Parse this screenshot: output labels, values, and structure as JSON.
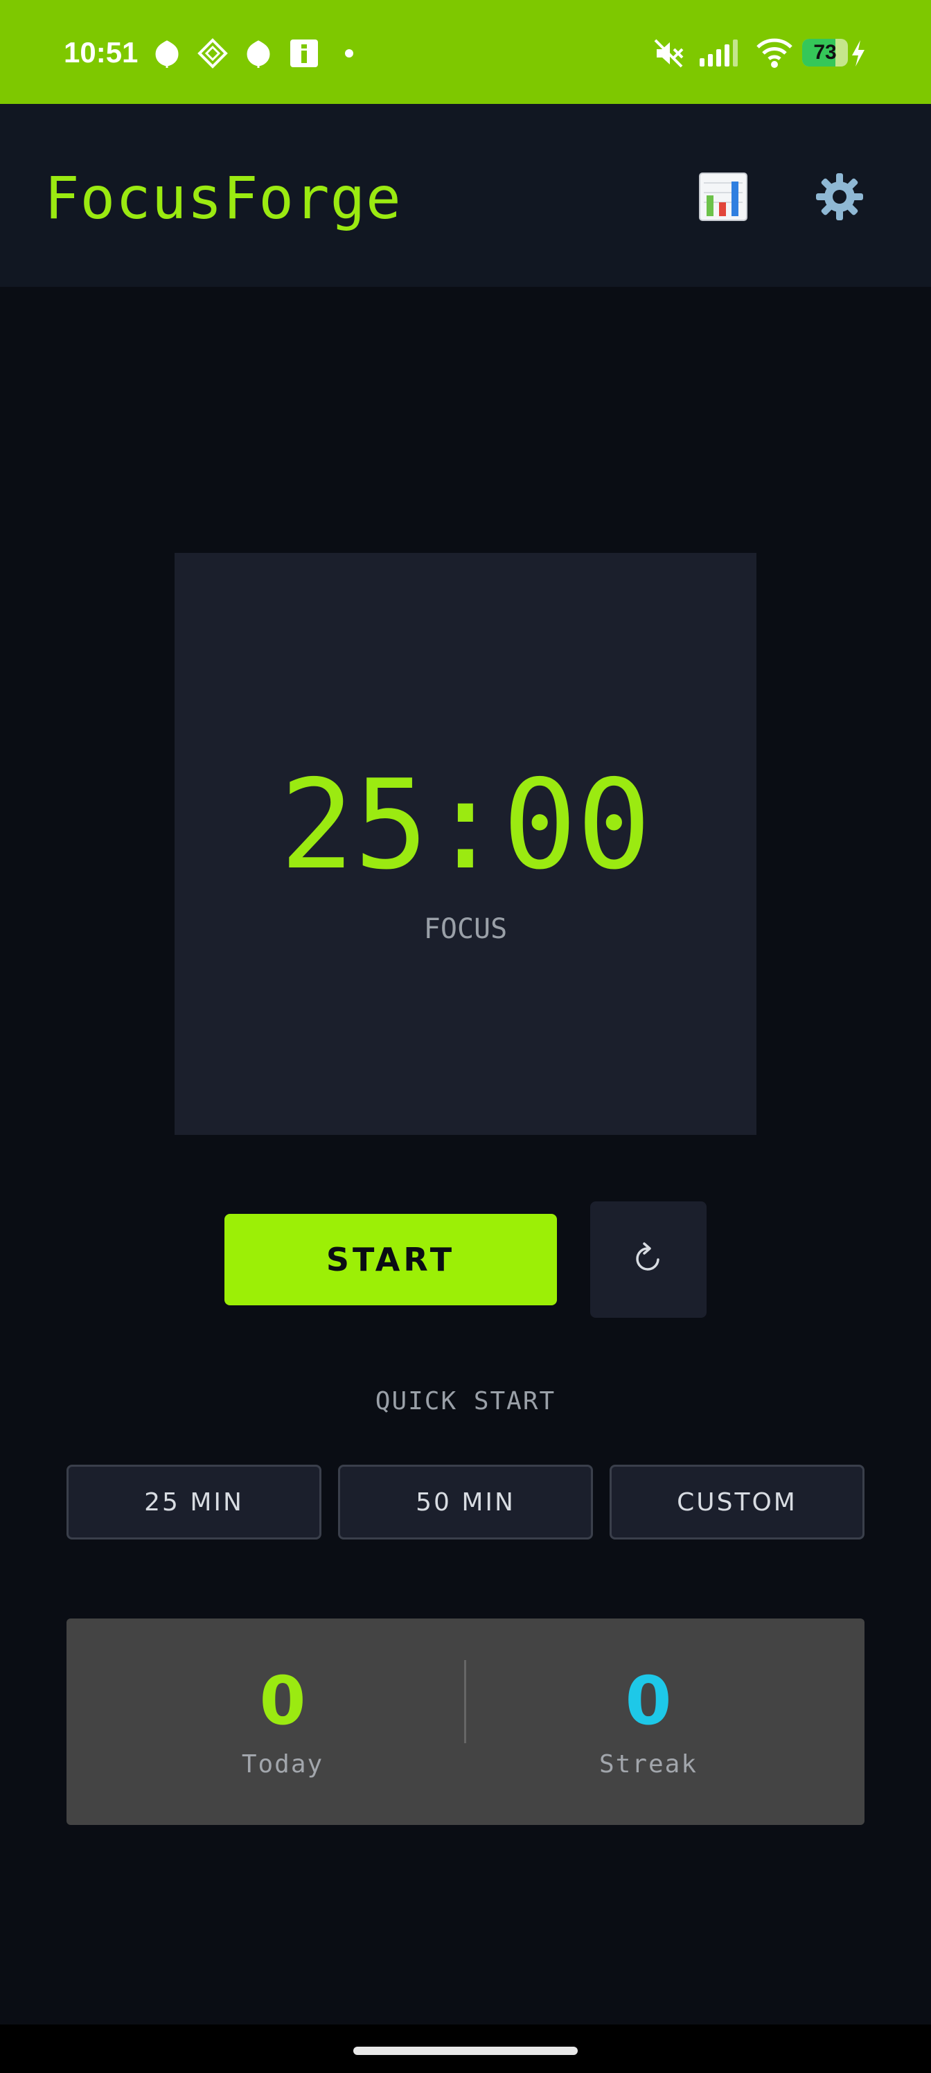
{
  "status_bar": {
    "time": "10:51",
    "left_icons": [
      "leaf-notification-icon",
      "diamond-app-icon",
      "leaf-notification-icon",
      "info-app-icon",
      "dot-icon"
    ],
    "right_icons": [
      "muted-icon",
      "cellular-signal-icon",
      "wifi-icon",
      "battery-icon",
      "charging-icon"
    ],
    "battery_level": "73",
    "battery_fraction": 0.73,
    "background_color": "#7ec800"
  },
  "header": {
    "title": "FocusForge",
    "stats_button_icon": "bar-chart-icon",
    "settings_button_icon": "gear-icon"
  },
  "timer": {
    "display": "25:00",
    "mode": "FOCUS"
  },
  "controls": {
    "start_label": "START",
    "reset_icon": "refresh-icon"
  },
  "quick_start": {
    "label": "QUICK START",
    "presets": [
      {
        "label": "25 MIN"
      },
      {
        "label": "50 MIN"
      },
      {
        "label": "CUSTOM"
      }
    ]
  },
  "stats": {
    "today": {
      "value": "0",
      "label": "Today"
    },
    "streak": {
      "value": "0",
      "label": "Streak"
    }
  },
  "colors": {
    "accent": "#9bea11",
    "streak_accent": "#1ec8e8",
    "background": "#0a0d14",
    "card": "#1b1f2c"
  }
}
